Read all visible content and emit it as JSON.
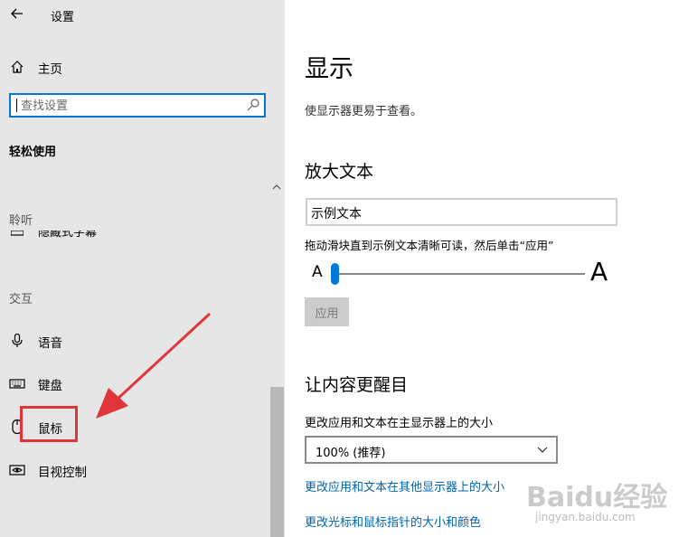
{
  "window": {
    "title": "设置"
  },
  "sidebar": {
    "home_label": "主页",
    "search_placeholder": "查找设置",
    "category_title": "轻松使用",
    "section_hearing": "聆听",
    "partial_item_label": "隐藏式字幕",
    "section_interaction": "交互",
    "items": [
      {
        "label": "语音",
        "icon": "microphone-icon"
      },
      {
        "label": "键盘",
        "icon": "keyboard-icon"
      },
      {
        "label": "鼠标",
        "icon": "mouse-icon"
      },
      {
        "label": "目视控制",
        "icon": "eye-control-icon"
      }
    ]
  },
  "main": {
    "title": "显示",
    "subtitle": "使显示器更易于查看。",
    "enlarge_text": {
      "heading": "放大文本",
      "sample_text": "示例文本",
      "instruction": "拖动滑块直到示例文本清晰可读，然后单击“应用”",
      "small_a": "A",
      "large_a": "A",
      "slider_value": 0,
      "apply_label": "应用"
    },
    "make_bigger": {
      "heading": "让内容更醒目",
      "size_label": "更改应用和文本在主显示器上的大小",
      "dropdown_value": "100% (推荐)",
      "link_other_displays": "更改应用和文本在其他显示器上的大小",
      "link_pointer": "更改光标和鼠标指针的大小和颜色"
    }
  },
  "watermark": {
    "logo": "Baidu经验",
    "url": "jingyan.baidu.com"
  },
  "colors": {
    "accent": "#0078d7",
    "highlight": "#e0353a",
    "link": "#0063b1",
    "sidebar_bg": "#e6e6e6"
  }
}
